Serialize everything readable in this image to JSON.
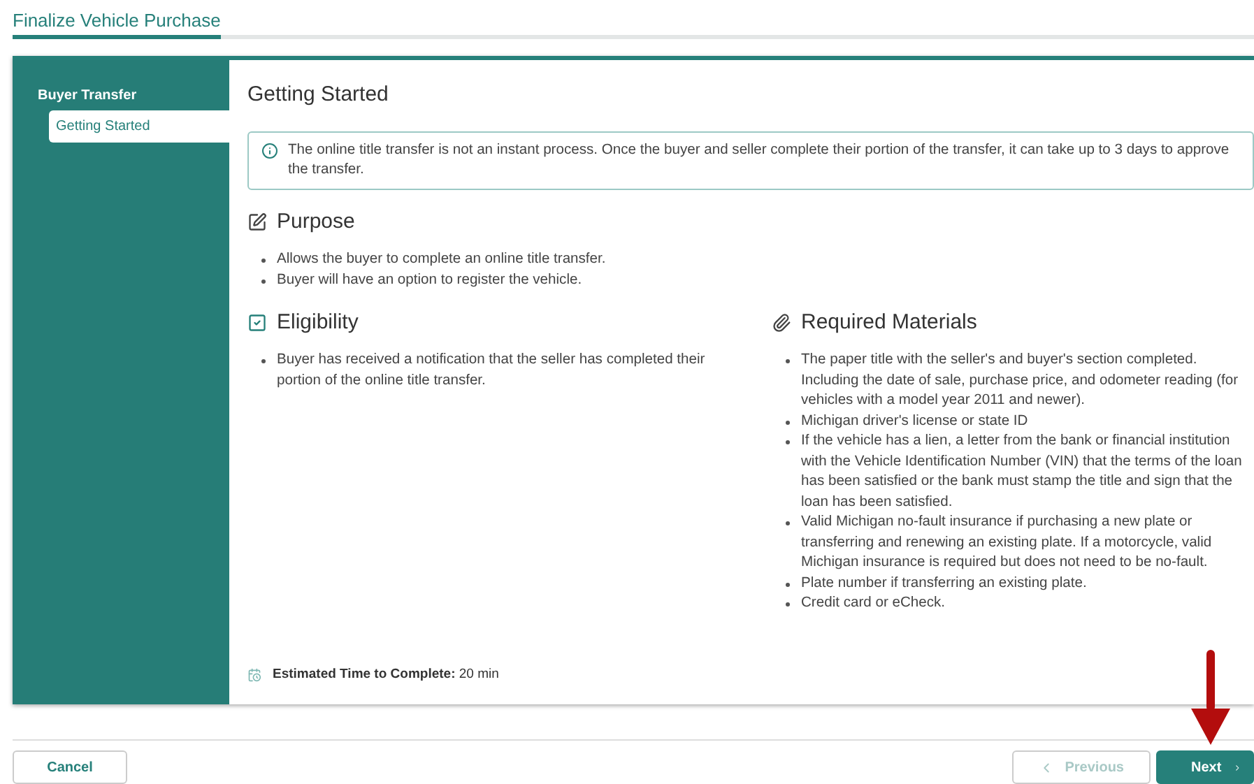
{
  "page": {
    "title": "Finalize Vehicle Purchase"
  },
  "sidebar": {
    "group": "Buyer Transfer",
    "items": [
      {
        "label": "Getting Started",
        "selected": true
      }
    ]
  },
  "content": {
    "heading": "Getting Started",
    "notice": "The online title transfer is not an instant process. Once the buyer and seller complete their portion of the transfer, it can take up to 3 days to approve the transfer.",
    "sections": [
      {
        "kind": "purpose",
        "title": "Purpose",
        "items": [
          "Allows the buyer to complete an online title transfer.",
          "Buyer will have an option to register the vehicle."
        ]
      },
      {
        "kind": "eligibility",
        "title": "Eligibility",
        "items": [
          "Buyer has received a notification that the seller has completed their portion of the online title transfer."
        ]
      },
      {
        "kind": "materials",
        "title": "Required Materials",
        "items": [
          "The paper title with the seller's and buyer's section completed. Including the date of sale, purchase price, and odometer reading (for vehicles with a model year 2011 and newer).",
          "Michigan driver's license or state ID",
          "If the vehicle has a lien, a letter from the bank or financial institution with the Vehicle Identification Number (VIN) that the terms of the loan has been satisfied or the bank must stamp the title and sign that the loan has been satisfied.",
          "Valid Michigan no-fault insurance if purchasing a new plate or transferring and renewing an existing plate. If a motorcycle, valid Michigan insurance is required but does not need to be no-fault.",
          "Plate number if transferring an existing plate.",
          "Credit card or eCheck."
        ]
      }
    ],
    "estimate": "**Estimated Time to Complete:** 20 min"
  },
  "footer": {
    "cancel": "Cancel",
    "previous": {
      "label": "Previous",
      "disabled": true
    },
    "next": {
      "label": "Next",
      "disabled": false
    }
  }
}
